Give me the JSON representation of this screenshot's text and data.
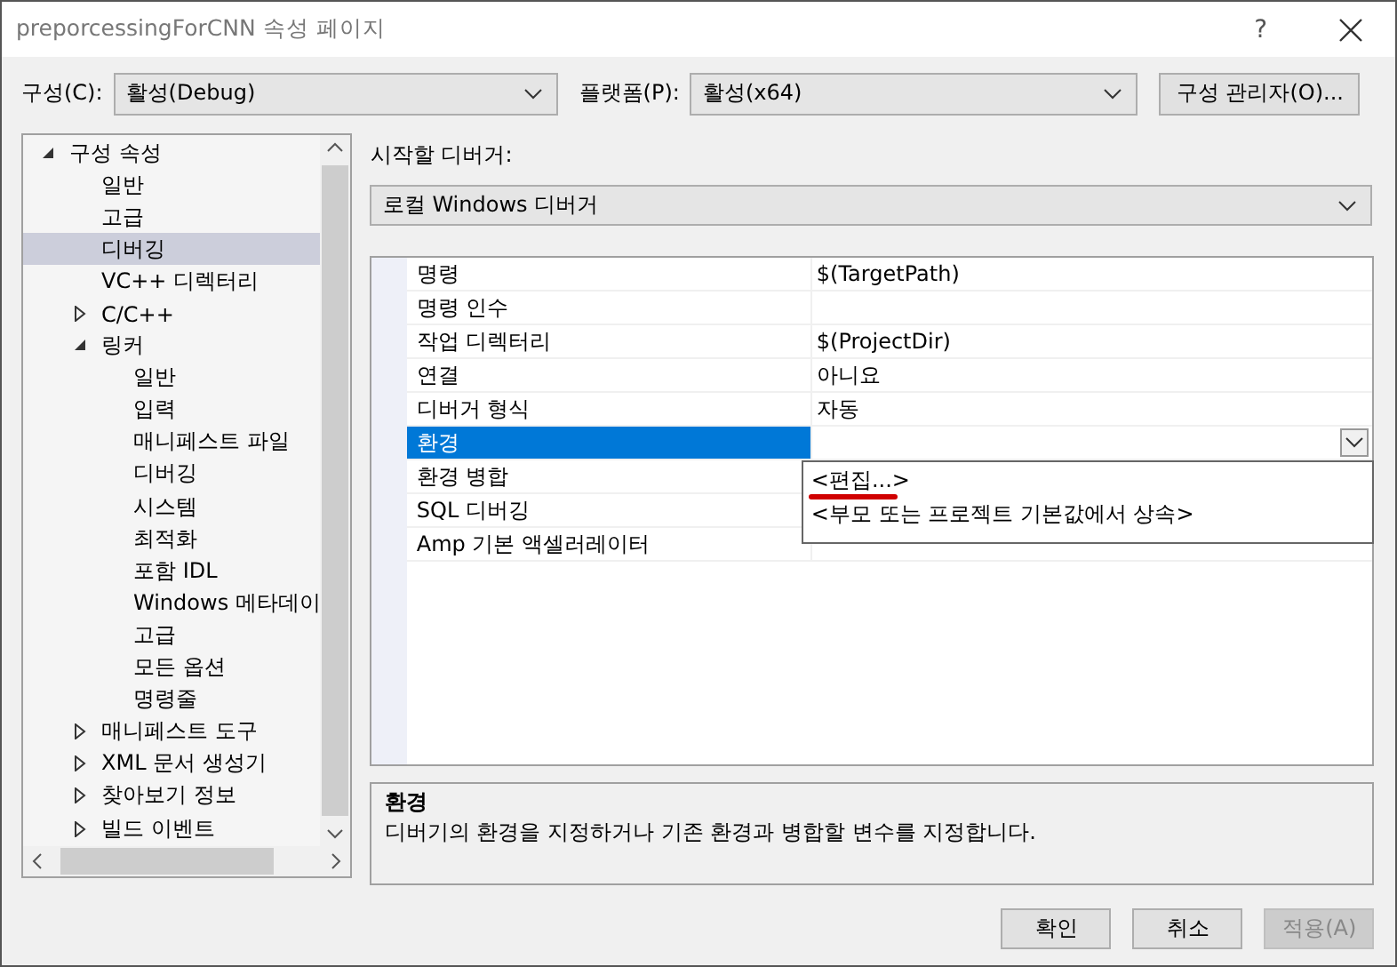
{
  "window": {
    "title": "preporcessingForCNN 속성 페이지",
    "help": "?"
  },
  "toolbar": {
    "config_label": "구성(C):",
    "config_value": "활성(Debug)",
    "platform_label": "플랫폼(P):",
    "platform_value": "활성(x64)",
    "manager_button": "구성 관리자(O)..."
  },
  "tree": [
    {
      "label": "구성 속성",
      "expanded": true,
      "selected": false,
      "children": [
        {
          "label": "일반",
          "selected": false
        },
        {
          "label": "고급",
          "selected": false
        },
        {
          "label": "디버깅",
          "selected": true
        },
        {
          "label": "VC++ 디렉터리",
          "selected": false
        },
        {
          "label": "C/C++",
          "expanded": false,
          "selected": false
        },
        {
          "label": "링커",
          "expanded": true,
          "selected": false,
          "children": [
            {
              "label": "일반",
              "selected": false
            },
            {
              "label": "입력",
              "selected": false
            },
            {
              "label": "매니페스트 파일",
              "selected": false
            },
            {
              "label": "디버깅",
              "selected": false
            },
            {
              "label": "시스템",
              "selected": false
            },
            {
              "label": "최적화",
              "selected": false
            },
            {
              "label": "포함 IDL",
              "selected": false
            },
            {
              "label": "Windows 메타데이",
              "selected": false
            },
            {
              "label": "고급",
              "selected": false
            },
            {
              "label": "모든 옵션",
              "selected": false
            },
            {
              "label": "명령줄",
              "selected": false
            }
          ]
        },
        {
          "label": "매니페스트 도구",
          "expanded": false,
          "selected": false
        },
        {
          "label": "XML 문서 생성기",
          "expanded": false,
          "selected": false
        },
        {
          "label": "찾아보기 정보",
          "expanded": false,
          "selected": false
        },
        {
          "label": "빌드 이벤트",
          "expanded": false,
          "selected": false
        }
      ]
    }
  ],
  "debugger": {
    "label": "시작할 디버거:",
    "value": "로컬 Windows 디버거"
  },
  "properties": [
    {
      "name": "명령",
      "value": "$(TargetPath)",
      "selected": false
    },
    {
      "name": "명령 인수",
      "selected": false
    },
    {
      "name": "작업 디렉터리",
      "value": "$(ProjectDir)",
      "selected": false
    },
    {
      "name": "연결",
      "value": "아니요",
      "selected": false
    },
    {
      "name": "디버거 형식",
      "value": "자동",
      "selected": false
    },
    {
      "name": "환경",
      "selected": true
    },
    {
      "name": "환경 병합",
      "selected": false
    },
    {
      "name": "SQL 디버깅",
      "selected": false
    },
    {
      "name": "Amp 기본 액셀러레이터",
      "selected": false
    }
  ],
  "dropdown": {
    "items": [
      "<편집...>",
      "<부모 또는 프로젝트 기본값에서 상속>"
    ]
  },
  "description": {
    "title": "환경",
    "text": "디버기의 환경을 지정하거나 기존 환경과 병합할 변수를 지정합니다."
  },
  "buttons": [
    {
      "label": "확인",
      "disabled": false
    },
    {
      "label": "취소",
      "disabled": false
    },
    {
      "label": "적용(A)",
      "disabled": true
    }
  ]
}
